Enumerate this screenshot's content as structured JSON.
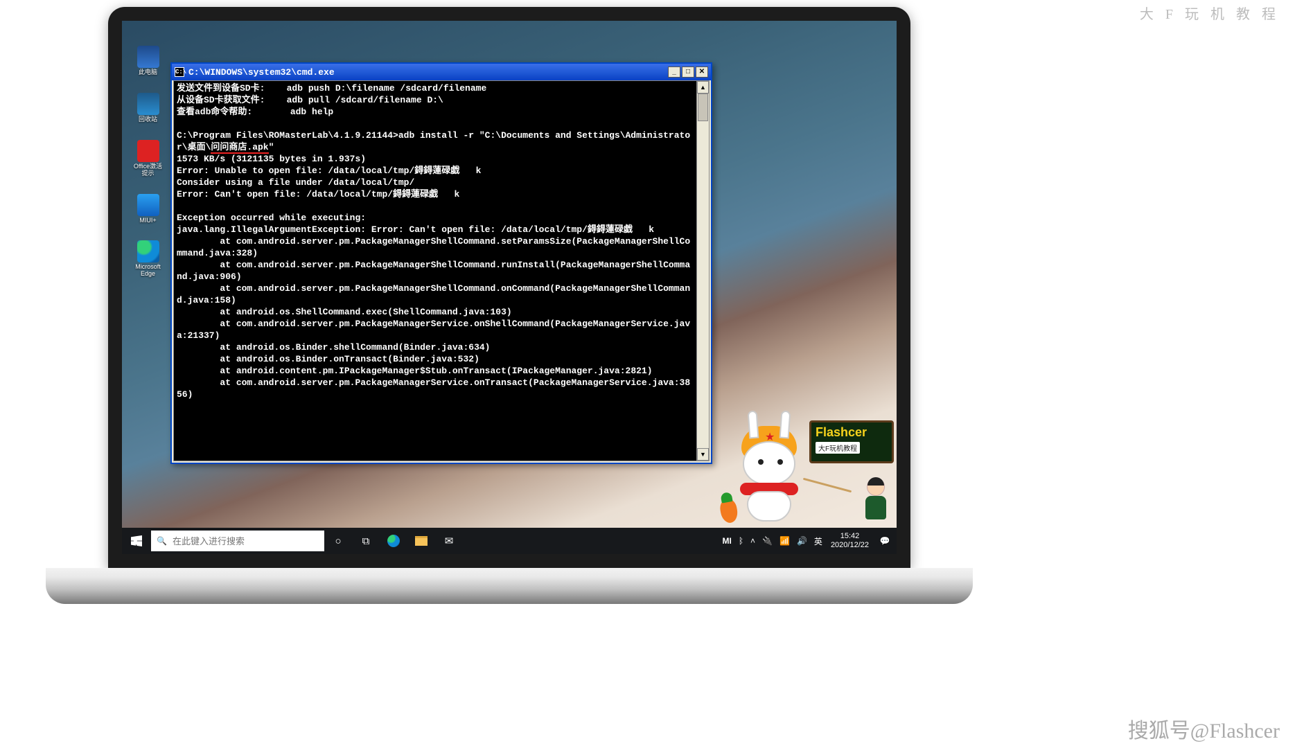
{
  "outer_watermarks": {
    "tr": "大 F 玩 机 教 程",
    "br": "搜狐号@Flashcer"
  },
  "desktop_icons": [
    {
      "label": "此电脑"
    },
    {
      "label": "回收站"
    },
    {
      "label": "Office激活提示"
    },
    {
      "label": "MIUI+"
    },
    {
      "label": "Microsoft Edge"
    }
  ],
  "cmd": {
    "title": "C:\\WINDOWS\\system32\\cmd.exe",
    "icon_text": "C:\\",
    "lines_top": [
      "发送文件到设备SD卡:    adb push D:\\filename /sdcard/filename",
      "从设备SD卡获取文件:    adb pull /sdcard/filename D:\\",
      "查看adb命令帮助:       adb help",
      ""
    ],
    "prompt_pre": "C:\\Program Files\\ROMasterLab\\4.1.9.21144>adb install -r \"C:\\Documents and Settings\\Administrator\\桌面\\",
    "underlined": "问问商店.apk",
    "prompt_post": "\"",
    "lines_mid": [
      "1573 KB/s (3121135 bytes in 1.937s)",
      "Error: Unable to open file: /data/local/tmp/鍀鍀蓮碌戯   k",
      "Consider using a file under /data/local/tmp/",
      "Error: Can't open file: /data/local/tmp/鍀鍀蓮碌戯   k",
      "",
      "Exception occurred while executing:",
      "java.lang.IllegalArgumentException: Error: Can't open file: /data/local/tmp/鍀鍀蓮碌戯   k",
      "        at com.android.server.pm.PackageManagerShellCommand.setParamsSize(PackageManagerShellCommand.java:328)",
      "        at com.android.server.pm.PackageManagerShellCommand.runInstall(PackageManagerShellCommand.java:906)",
      "        at com.android.server.pm.PackageManagerShellCommand.onCommand(PackageManagerShellCommand.java:158)",
      "        at android.os.ShellCommand.exec(ShellCommand.java:103)",
      "        at com.android.server.pm.PackageManagerService.onShellCommand(PackageManagerService.java:21337)",
      "        at android.os.Binder.shellCommand(Binder.java:634)",
      "        at android.os.Binder.onTransact(Binder.java:532)",
      "        at android.content.pm.IPackageManager$Stub.onTransact(IPackageManager.java:2821)",
      "        at com.android.server.pm.PackageManagerService.onTransact(PackageManagerService.java:3856)"
    ]
  },
  "mascot": {
    "title": "Flashcer",
    "subtitle": "大F玩机教程"
  },
  "taskbar": {
    "search_placeholder": "在此键入进行搜索",
    "tray": {
      "lang": "英",
      "mi": "MI",
      "time": "15:42",
      "date": "2020/12/22"
    }
  }
}
